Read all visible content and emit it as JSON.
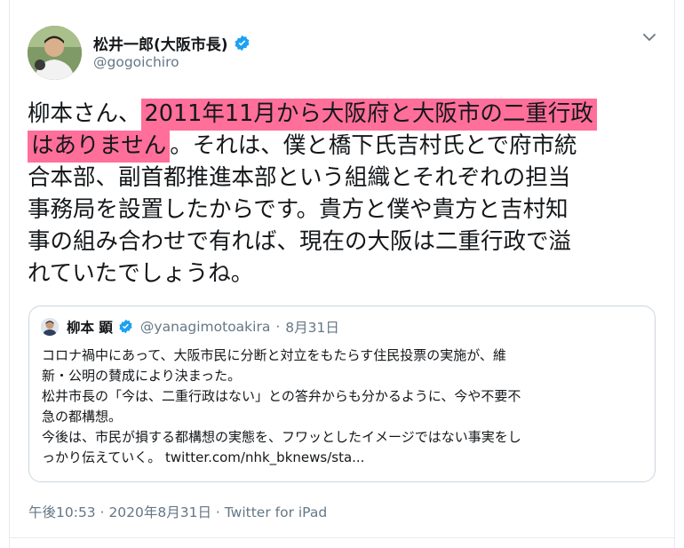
{
  "author": {
    "name": "松井一郎(大阪市長)",
    "handle": "@gogoichiro",
    "verified": true
  },
  "tweet": {
    "lines": [
      {
        "pre": "柳本さん、",
        "highlight": "2011年11月から大阪府と大阪市の二重行政",
        "post": ""
      },
      {
        "pre": "",
        "highlight": "はありません",
        "post": "。それは、僕と橋下氏吉村氏とで府市統"
      },
      {
        "pre": "合本部、副首都推進本部という組織とそれぞれの担当",
        "highlight": "",
        "post": ""
      },
      {
        "pre": "事務局を設置したからです。貴方と僕や貴方と吉村知",
        "highlight": "",
        "post": ""
      },
      {
        "pre": "事の組み合わせで有れば、現在の大阪は二重行政で溢",
        "highlight": "",
        "post": ""
      },
      {
        "pre": "れていたでしょうね。",
        "highlight": "",
        "post": ""
      }
    ],
    "highlight_color": "#ff6f9a"
  },
  "quote": {
    "name": "柳本 顕",
    "handle": "@yanagimotoakira",
    "date": "8月31日",
    "separator": "·",
    "lines": [
      "コロナ禍中にあって、大阪市民に分断と対立をもたらす住民投票の実施が、維",
      "新・公明の賛成により決まった。",
      "松井市長の「今は、二重行政はない」との答弁からも分かるように、今や不要不",
      "急の都構想。",
      "今後は、市民が損する都構想の実態を、フワッとしたイメージではない事実をし",
      "っかり伝えていく。 twitter.com/nhk_bknews/sta..."
    ]
  },
  "meta": {
    "text": "午後10:53 · 2020年8月31日 · Twitter for iPad"
  },
  "colors": {
    "verified": "#1da1f2",
    "secondary_text": "#657786",
    "border": "#ccd6dd"
  }
}
